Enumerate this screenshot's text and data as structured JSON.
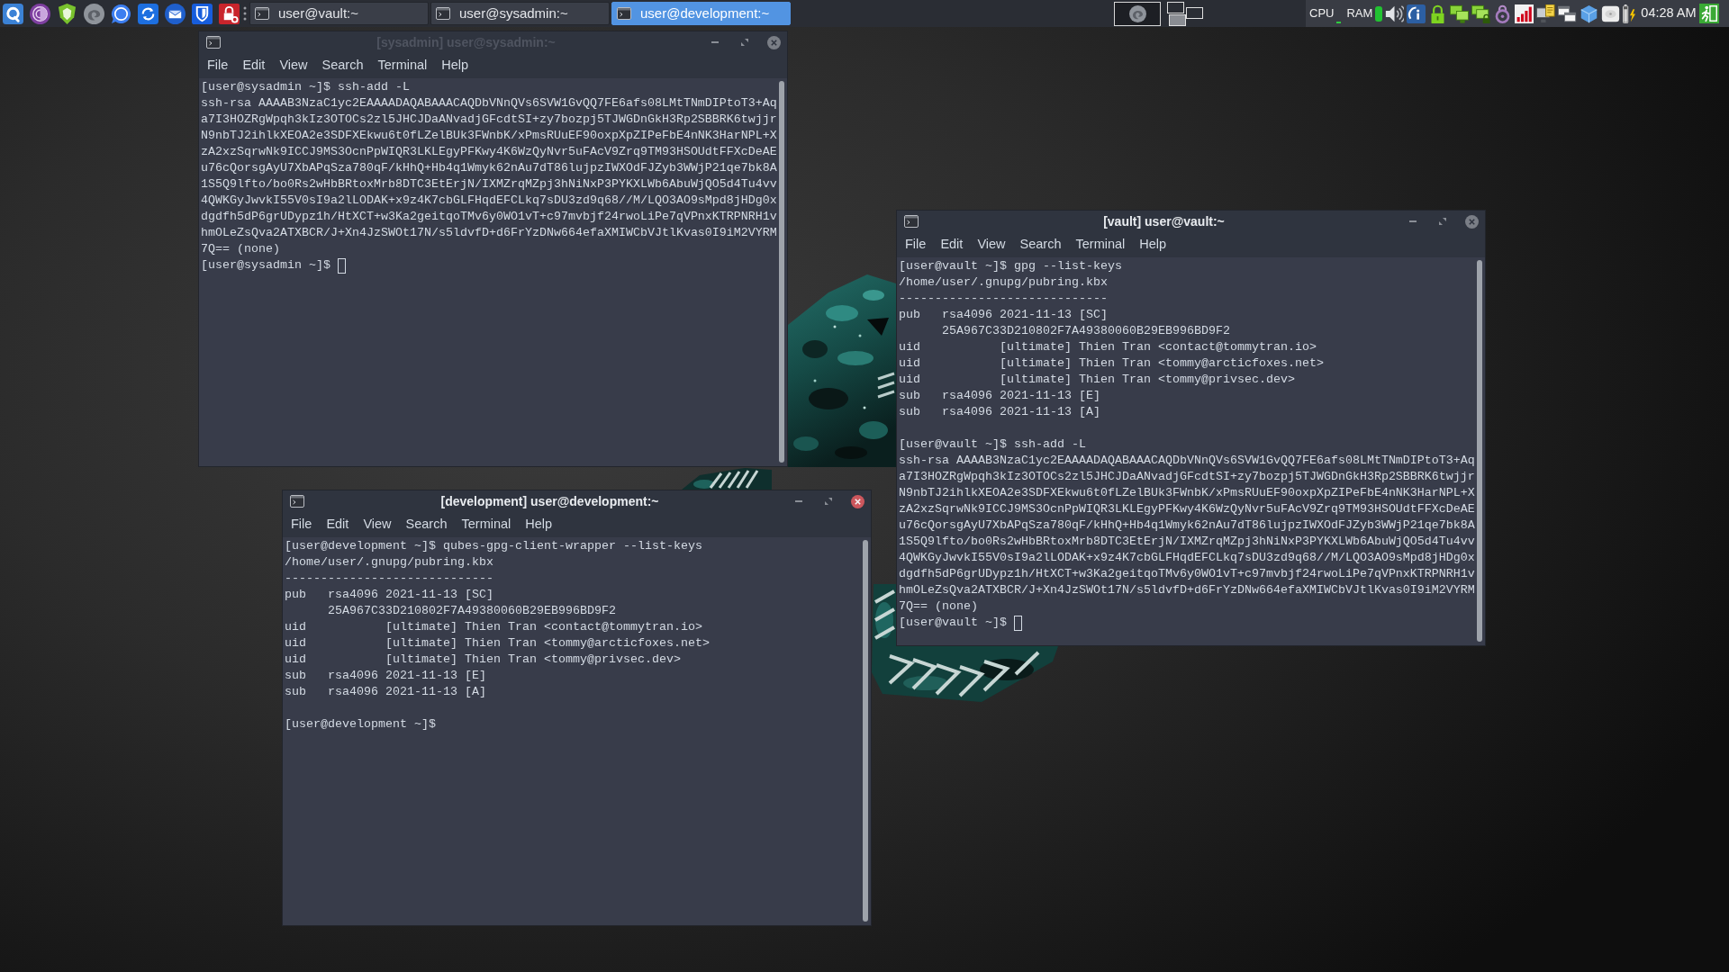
{
  "taskbar": {
    "tasks": [
      {
        "label": "user@vault:~",
        "selected": false
      },
      {
        "label": "user@sysadmin:~",
        "selected": false
      },
      {
        "label": "user@development:~",
        "selected": true
      }
    ],
    "tray": {
      "cpu_label": "CPU",
      "ram_label": "RAM",
      "clock": "04:28 AM"
    }
  },
  "windows": [
    {
      "title": "[sysadmin] user@sysadmin:~",
      "title_dimmed": true,
      "focused": false,
      "menu": [
        "File",
        "Edit",
        "View",
        "Search",
        "Terminal",
        "Help"
      ],
      "output": [
        [
          "[user@sysadmin ~]$ ssh-add -L",
          "ssh-rsa AAAAB3NzaC1yc2EAAAADAQABAAACAQDbVNnQVs6SVW1GvQQ7FE6afs08LMtTNmDIPtoT3+Aq",
          "a7I3HOZRgWpqh3kIz3OTOCs2zl5JHCJDaANvadjGFcdtSI+zy7bozpj5TJWGDnGkH3Rp2SBBRK6twjjr",
          "N9nbTJ2ihlkXEOA2e3SDFXEkwu6t0fLZelBUk3FWnbK/xPmsRUuEF90oxpXpZIPeFbE4nNK3HarNPL+X",
          "zA2xzSqrwNk9ICCJ9MS3OcnPpWIQR3LKLEgyPFKwy4K6WzQyNvr5uFAcV9Zrq9TM93HSOUdtFFXcDeAE",
          "u76cQorsgAyU7XbAPqSza780qF/kHhQ+Hb4q1Wmyk62nAu7dT86lujpzIWXOdFJZyb3WWjP21qe7bk8A",
          "1S5Q9lfto/bo0Rs2wHbBRtoxMrb8DTC3EtErjN/IXMZrqMZpj3hNiNxP3PYKXLWb6AbuWjQO5d4Tu4vv",
          "4QWKGyJwvkI55V0sI9a2lLODAK+x9z4K7cbGLFHqdEFCLkq7sDU3zd9q68//M/LQO3AO9sMpd8jHDg0x",
          "dgdfh5dP6grUDypz1h/HtXCT+w3Ka2geitqoTMv6y0WO1vT+c97mvbjf24rwoLiPe7qVPnxKTRPNRH1v",
          "hmOLeZsQva2ATXBCR/J+Xn4JzSWOt17N/s5ldvfD+d6FrYzDNw664efaXMIWCbVJtlKvas0I9iM2VYRM",
          "7Q== (none)",
          "[user@sysadmin ~]$"
        ]
      ],
      "cursor": true
    },
    {
      "title": "[vault] user@vault:~",
      "title_dimmed": false,
      "focused": false,
      "menu": [
        "File",
        "Edit",
        "View",
        "Search",
        "Terminal",
        "Help"
      ],
      "output": [
        [
          "[user@vault ~]$ gpg --list-keys",
          "/home/user/.gnupg/pubring.kbx",
          "-----------------------------",
          "pub   rsa4096 2021-11-13 [SC]",
          "      25A967C33D210802F7A49380060B29EB996BD9F2",
          "uid           [ultimate] Thien Tran <contact@tommytran.io>",
          "uid           [ultimate] Thien Tran <tommy@arcticfoxes.net>",
          "uid           [ultimate] Thien Tran <tommy@privsec.dev>",
          "sub   rsa4096 2021-11-13 [E]",
          "sub   rsa4096 2021-11-13 [A]"
        ],
        [
          "[user@vault ~]$ ssh-add -L",
          "ssh-rsa AAAAB3NzaC1yc2EAAAADAQABAAACAQDbVNnQVs6SVW1GvQQ7FE6afs08LMtTNmDIPtoT3+Aq",
          "a7I3HOZRgWpqh3kIz3OTOCs2zl5JHCJDaANvadjGFcdtSI+zy7bozpj5TJWGDnGkH3Rp2SBBRK6twjjr",
          "N9nbTJ2ihlkXEOA2e3SDFXEkwu6t0fLZelBUk3FWnbK/xPmsRUuEF90oxpXpZIPeFbE4nNK3HarNPL+X",
          "zA2xzSqrwNk9ICCJ9MS3OcnPpWIQR3LKLEgyPFKwy4K6WzQyNvr5uFAcV9Zrq9TM93HSOUdtFFXcDeAE",
          "u76cQorsgAyU7XbAPqSza780qF/kHhQ+Hb4q1Wmyk62nAu7dT86lujpzIWXOdFJZyb3WWjP21qe7bk8A",
          "1S5Q9lfto/bo0Rs2wHbBRtoxMrb8DTC3EtErjN/IXMZrqMZpj3hNiNxP3PYKXLWb6AbuWjQO5d4Tu4vv",
          "4QWKGyJwvkI55V0sI9a2lLODAK+x9z4K7cbGLFHqdEFCLkq7sDU3zd9q68//M/LQO3AO9sMpd8jHDg0x",
          "dgdfh5dP6grUDypz1h/HtXCT+w3Ka2geitqoTMv6y0WO1vT+c97mvbjf24rwoLiPe7qVPnxKTRPNRH1v",
          "hmOLeZsQva2ATXBCR/J+Xn4JzSWOt17N/s5ldvfD+d6FrYzDNw664efaXMIWCbVJtlKvas0I9iM2VYRM",
          "7Q== (none)",
          "[user@vault ~]$"
        ]
      ],
      "cursor": true
    },
    {
      "title": "[development] user@development:~",
      "title_dimmed": false,
      "focused": true,
      "menu": [
        "File",
        "Edit",
        "View",
        "Search",
        "Terminal",
        "Help"
      ],
      "output": [
        [
          "[user@development ~]$ qubes-gpg-client-wrapper --list-keys",
          "/home/user/.gnupg/pubring.kbx",
          "-----------------------------",
          "pub   rsa4096 2021-11-13 [SC]",
          "      25A967C33D210802F7A49380060B29EB996BD9F2",
          "uid           [ultimate] Thien Tran <contact@tommytran.io>",
          "uid           [ultimate] Thien Tran <tommy@arcticfoxes.net>",
          "uid           [ultimate] Thien Tran <tommy@privsec.dev>",
          "sub   rsa4096 2021-11-13 [E]",
          "sub   rsa4096 2021-11-13 [A]"
        ],
        [
          "[user@development ~]$"
        ]
      ],
      "cursor": false
    }
  ]
}
